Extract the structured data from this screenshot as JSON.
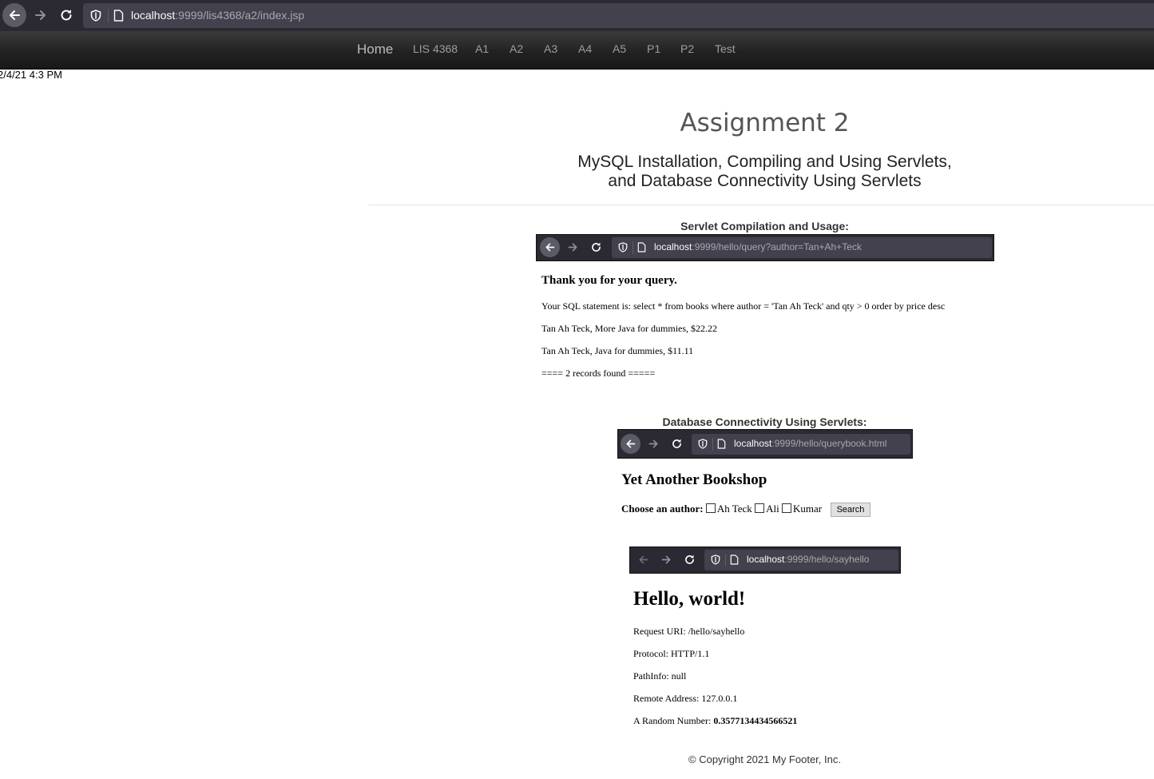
{
  "browser": {
    "url_host": "localhost",
    "url_rest": ":9999/lis4368/a2/index.jsp"
  },
  "navbar": {
    "brand": "Home",
    "items": [
      "LIS 4368",
      "A1",
      "A2",
      "A3",
      "A4",
      "A5",
      "P1",
      "P2",
      "Test"
    ]
  },
  "datestamp": "2/4/21 4:3 PM",
  "page": {
    "title": "Assignment 2",
    "subtitle_line1": "MySQL Installation, Compiling and Using Servlets,",
    "subtitle_line2": "and Database Connectivity Using Servlets"
  },
  "servlet_section": {
    "caption": "Servlet Compilation and Usage:",
    "url_host": "localhost",
    "url_rest": ":9999/hello/query?author=Tan+Ah+Teck",
    "heading": "Thank you for your query.",
    "sql": "Your SQL statement is: select * from books where author = 'Tan Ah Teck' and qty > 0 order by price desc",
    "results": [
      "Tan Ah Teck, More Java for dummies, $22.22",
      "Tan Ah Teck, Java for dummies, $11.11"
    ],
    "count": "==== 2 records found ====="
  },
  "db_section": {
    "caption": "Database Connectivity Using Servlets:",
    "url_host": "localhost",
    "url_rest": ":9999/hello/querybook.html",
    "heading": "Yet Another Bookshop",
    "prompt": "Choose an author:",
    "authors": [
      "Ah Teck",
      "Ali",
      "Kumar"
    ],
    "search_label": "Search"
  },
  "hello_section": {
    "url_host": "localhost",
    "url_rest": ":9999/hello/sayhello",
    "heading": "Hello, world!",
    "request_uri": "Request URI: /hello/sayhello",
    "protocol": "Protocol: HTTP/1.1",
    "pathinfo": "PathInfo: null",
    "remote": "Remote Address: 127.0.0.1",
    "random_label": "A Random Number:",
    "random_value": "0.3577134434566521"
  },
  "footer": "© Copyright 2021 My Footer, Inc.",
  "colors": {
    "chrome_bg": "#2b2a33",
    "urlbar_bg": "#42414d",
    "navbar_bg": "#222222",
    "title_color": "#555555"
  }
}
